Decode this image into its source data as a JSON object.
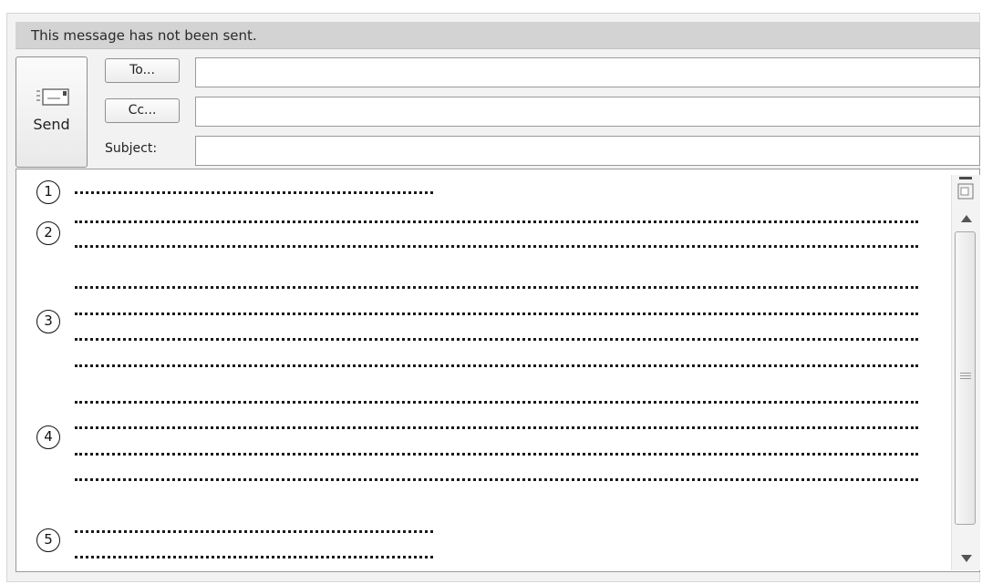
{
  "info_bar": {
    "text": "This message has not been sent."
  },
  "send": {
    "label": "Send",
    "icon": "envelope-send-icon"
  },
  "to": {
    "button_label": "To...",
    "value": ""
  },
  "cc": {
    "button_label": "Cc...",
    "value": ""
  },
  "subject": {
    "label": "Subject:",
    "value": ""
  },
  "body": {
    "markers": [
      "1",
      "2",
      "3",
      "4",
      "5"
    ]
  },
  "scrollbar": {
    "icons": [
      "split-view-icon",
      "scroll-up-icon",
      "scroll-grip-icon",
      "scroll-down-icon"
    ]
  }
}
